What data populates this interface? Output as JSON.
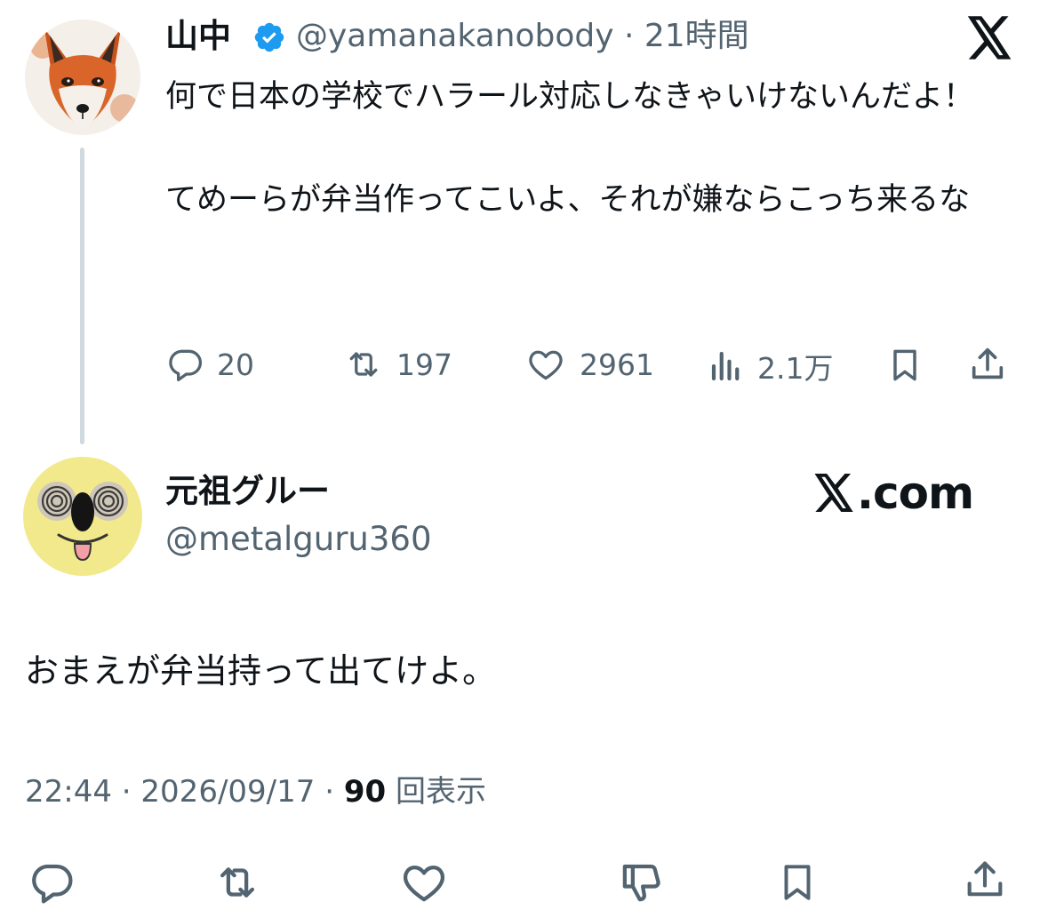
{
  "quoted_tweet": {
    "author_name": "山中",
    "handle_time": "@yamanakanobody · 21時間",
    "text_line1": "何で日本の学校でハラール対応しなきゃいけないんだよ！",
    "text_line2": "てめーらが弁当作ってこいよ、それが嫌ならこっち来るな",
    "actions": {
      "reply_count": "20",
      "retweet_count": "197",
      "like_count": "2961",
      "view_count": "2.1万"
    }
  },
  "reply_tweet": {
    "author_name": "元祖グルー",
    "handle": "@metalguru360",
    "brand": ".com",
    "text": "おまえが弁当持って出てけよ。",
    "time": "22:44",
    "date": "2026/09/17",
    "views_count": "90",
    "views_label": "回表示"
  },
  "colors": {
    "text_primary": "#0f1419",
    "text_secondary": "#536471",
    "verified_blue": "#1d9bf0",
    "thread_line": "#cfd9de"
  },
  "icons": [
    "x-logo-icon",
    "verified-badge-icon",
    "reply-icon",
    "retweet-icon",
    "like-icon",
    "views-icon",
    "bookmark-icon",
    "share-icon",
    "dislike-icon"
  ]
}
